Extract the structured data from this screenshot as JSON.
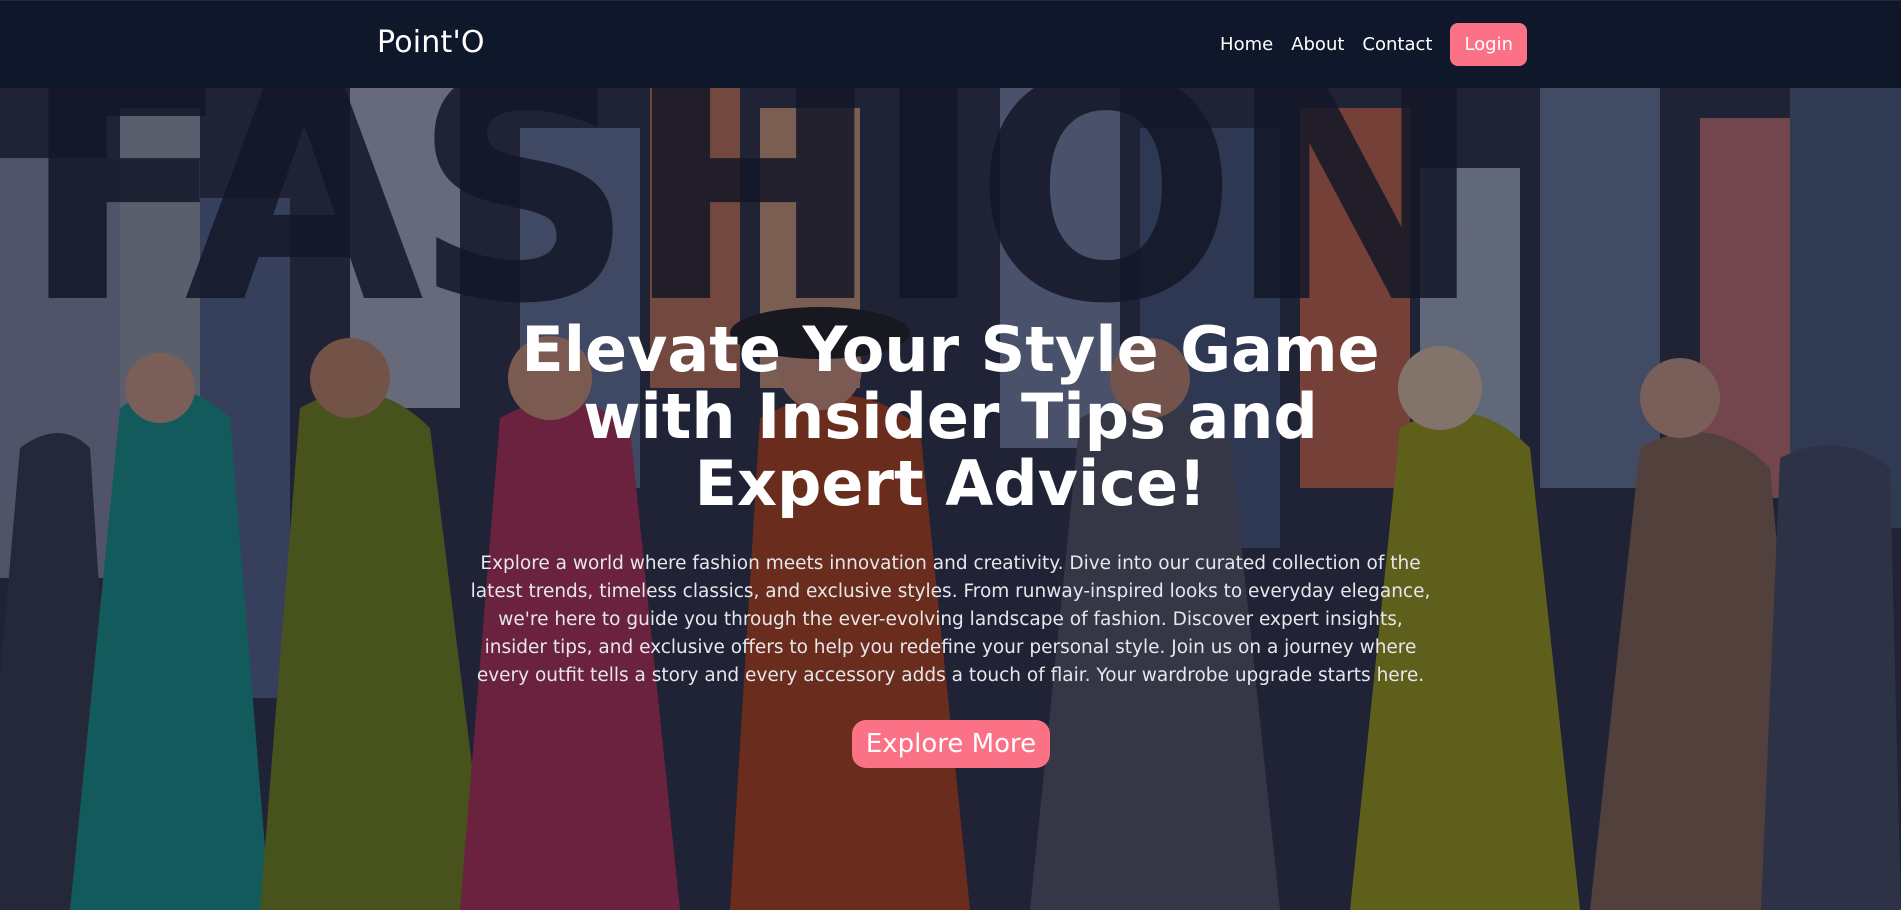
{
  "navbar": {
    "brand": "Point'O",
    "links": [
      "Home",
      "About",
      "Contact"
    ],
    "login_label": "Login"
  },
  "hero": {
    "title": "Elevate Your Style Game with Insider Tips and Expert Advice!",
    "description": "Explore a world where fashion meets innovation and creativity. Dive into our curated collection of the latest trends, timeless classics, and exclusive styles. From runway-inspired looks to everyday elegance, we're here to guide you through the ever-evolving landscape of fashion. Discover expert insights, insider tips, and exclusive offers to help you redefine your personal style. Join us on a journey where every outfit tells a story and every accessory adds a touch of flair. Your wardrobe upgrade starts here.",
    "cta_label": "Explore More",
    "background_word": "FASHION"
  },
  "colors": {
    "navbar_bg": "#0f172a",
    "accent": "#fb7185",
    "text": "#ffffff"
  }
}
